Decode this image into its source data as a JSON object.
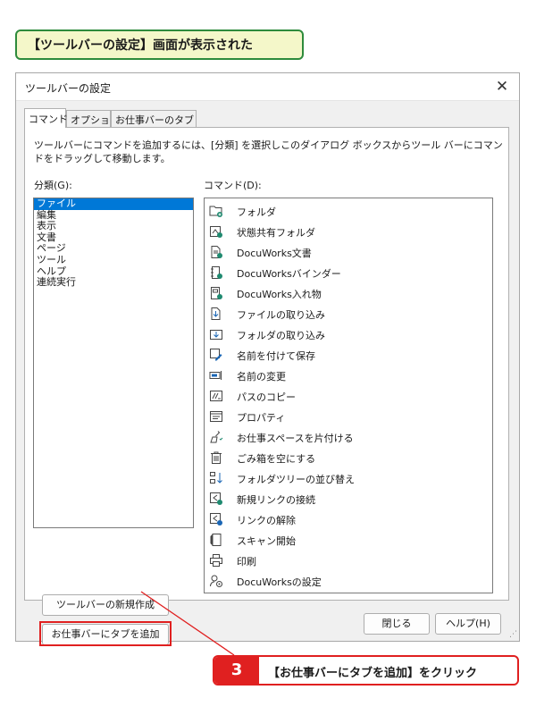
{
  "callout_top": "【ツールバーの設定】画面が表示された",
  "dialog": {
    "title": "ツールバーの設定",
    "tabs": [
      "コマンド",
      "オプション",
      "お仕事バーのタブ"
    ],
    "description": "ツールバーにコマンドを追加するには、[分類] を選択しこのダイアログ ボックスからツール バーにコマンドをドラッグして移動します。",
    "category_label": "分類(G):",
    "command_label": "コマンド(D):",
    "categories": [
      "ファイル",
      "編集",
      "表示",
      "文書",
      "ページ",
      "ツール",
      "ヘルプ",
      "連続実行"
    ],
    "selected_category": "ファイル",
    "commands": [
      {
        "label": "フォルダ",
        "icon": "folder-add-icon"
      },
      {
        "label": "状態共有フォルダ",
        "icon": "shared-folder-icon"
      },
      {
        "label": "DocuWorks文書",
        "icon": "document-add-icon"
      },
      {
        "label": "DocuWorksバインダー",
        "icon": "binder-add-icon"
      },
      {
        "label": "DocuWorks入れ物",
        "icon": "container-add-icon"
      },
      {
        "label": "ファイルの取り込み",
        "icon": "file-import-icon"
      },
      {
        "label": "フォルダの取り込み",
        "icon": "folder-import-icon"
      },
      {
        "label": "名前を付けて保存",
        "icon": "save-as-icon"
      },
      {
        "label": "名前の変更",
        "icon": "rename-icon"
      },
      {
        "label": "パスのコピー",
        "icon": "copy-path-icon"
      },
      {
        "label": "プロパティ",
        "icon": "properties-icon"
      },
      {
        "label": "お仕事スペースを片付ける",
        "icon": "cleanup-icon"
      },
      {
        "label": "ごみ箱を空にする",
        "icon": "trash-icon"
      },
      {
        "label": "フォルダツリーの並び替え",
        "icon": "sort-tree-icon"
      },
      {
        "label": "新規リンクの接続",
        "icon": "link-connect-icon"
      },
      {
        "label": "リンクの解除",
        "icon": "link-disconnect-icon"
      },
      {
        "label": "スキャン開始",
        "icon": "scan-icon"
      },
      {
        "label": "印刷",
        "icon": "printer-icon"
      },
      {
        "label": "DocuWorksの設定",
        "icon": "settings-icon"
      }
    ],
    "buttons": {
      "new_toolbar": "ツールバーの新規作成",
      "add_tab": "お仕事バーにタブを追加",
      "close": "閉じる",
      "help": "ヘルプ(H)"
    }
  },
  "callout_bottom": {
    "step": "3",
    "text": "【お仕事バーにタブを追加】をクリック"
  },
  "colors": {
    "accent": "#e02020",
    "selection": "#0078d7",
    "callout_border": "#2e8b3c",
    "callout_fill": "#f4f7c9"
  }
}
